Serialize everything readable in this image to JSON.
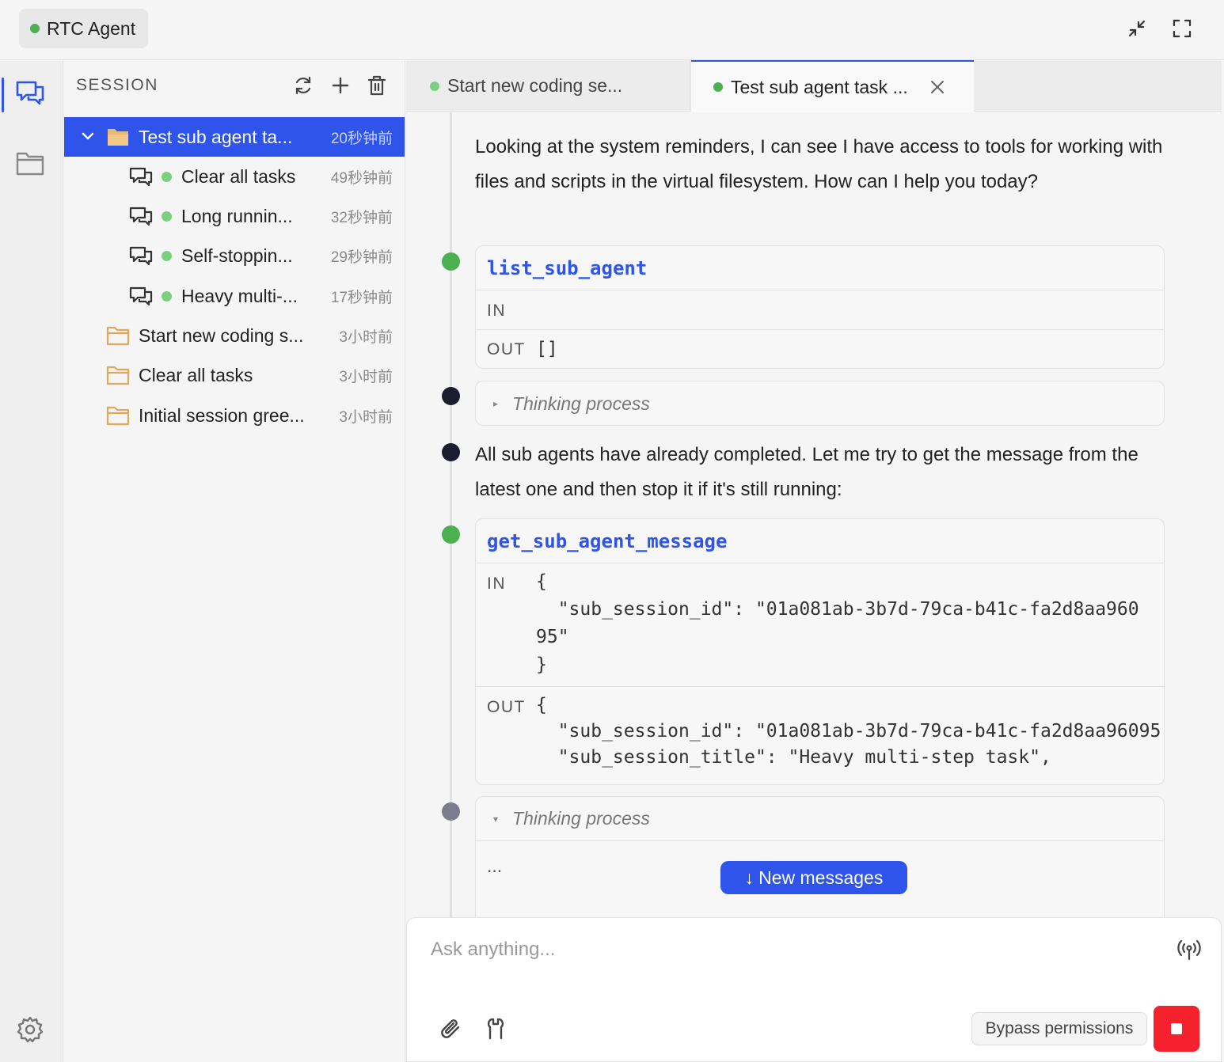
{
  "app": {
    "agent_name": "RTC Agent",
    "agent_status_color": "#4caf50",
    "accent_color": "#2f54eb"
  },
  "topbar": {
    "icons": [
      "collapse-icon",
      "fullscreen-icon"
    ]
  },
  "rail": {
    "items": [
      {
        "icon": "chat-bubbles-icon",
        "active": true
      },
      {
        "icon": "folder-icon",
        "active": false
      }
    ],
    "bottom_icon": "settings-gear-icon"
  },
  "sidebar": {
    "title": "SESSION",
    "tools": [
      "refresh-icon",
      "plus-icon",
      "trash-icon"
    ],
    "sessions": [
      {
        "label": "Test sub agent ta...",
        "time": "20秒钟前",
        "selected": true,
        "expanded": true,
        "type": "folder"
      },
      {
        "label": "Clear all tasks",
        "time": "49秒钟前",
        "type": "sub"
      },
      {
        "label": "Long runnin...",
        "time": "32秒钟前",
        "type": "sub"
      },
      {
        "label": "Self-stoppin...",
        "time": "29秒钟前",
        "type": "sub"
      },
      {
        "label": "Heavy multi-...",
        "time": "17秒钟前",
        "type": "sub"
      },
      {
        "label": "Start new coding s...",
        "time": "3小时前",
        "type": "folder"
      },
      {
        "label": "Clear all tasks",
        "time": "3小时前",
        "type": "folder"
      },
      {
        "label": "Initial session gree...",
        "time": "3小时前",
        "type": "folder"
      }
    ]
  },
  "tabs": [
    {
      "label": "Start new coding se...",
      "active": false
    },
    {
      "label": "Test sub agent task ...",
      "active": true
    }
  ],
  "chat": {
    "msg1": "Looking at the system reminders, I can see I have access to tools for working with files and scripts in the virtual filesystem. How can I help you today?",
    "tool1": {
      "name": "list_sub_agent",
      "in_label": "IN",
      "out_label": "OUT",
      "out_value": "[]"
    },
    "thinking1": "Thinking process",
    "msg2": "All sub agents have already completed. Let me try to get the message from the latest one and then stop it if it's still running:",
    "tool2": {
      "name": "get_sub_agent_message",
      "in_label": "IN",
      "in_line1": "{",
      "in_line2": "  \"sub_session_id\": \"01a081ab-3b7d-79ca-b41c-fa2d8aa960",
      "in_line3": "95\"",
      "in_line4": "}",
      "out_label": "OUT",
      "out_line1": "{",
      "out_line2": "  \"sub_session_id\": \"01a081ab-3b7d-79ca-b41c-fa2d8aa96095\",",
      "out_line3": "  \"sub_session_title\": \"Heavy multi-step task\","
    },
    "thinking2": "Thinking process",
    "thinking2_body": "...",
    "new_messages": "New messages",
    "new_messages_arrow": "↓"
  },
  "composer": {
    "placeholder": "Ask anything...",
    "bypass_label": "Bypass permissions",
    "icons": [
      "antenna-icon",
      "paperclip-icon",
      "tool-icon",
      "stop-icon"
    ],
    "stop_color": "#f5222d"
  }
}
